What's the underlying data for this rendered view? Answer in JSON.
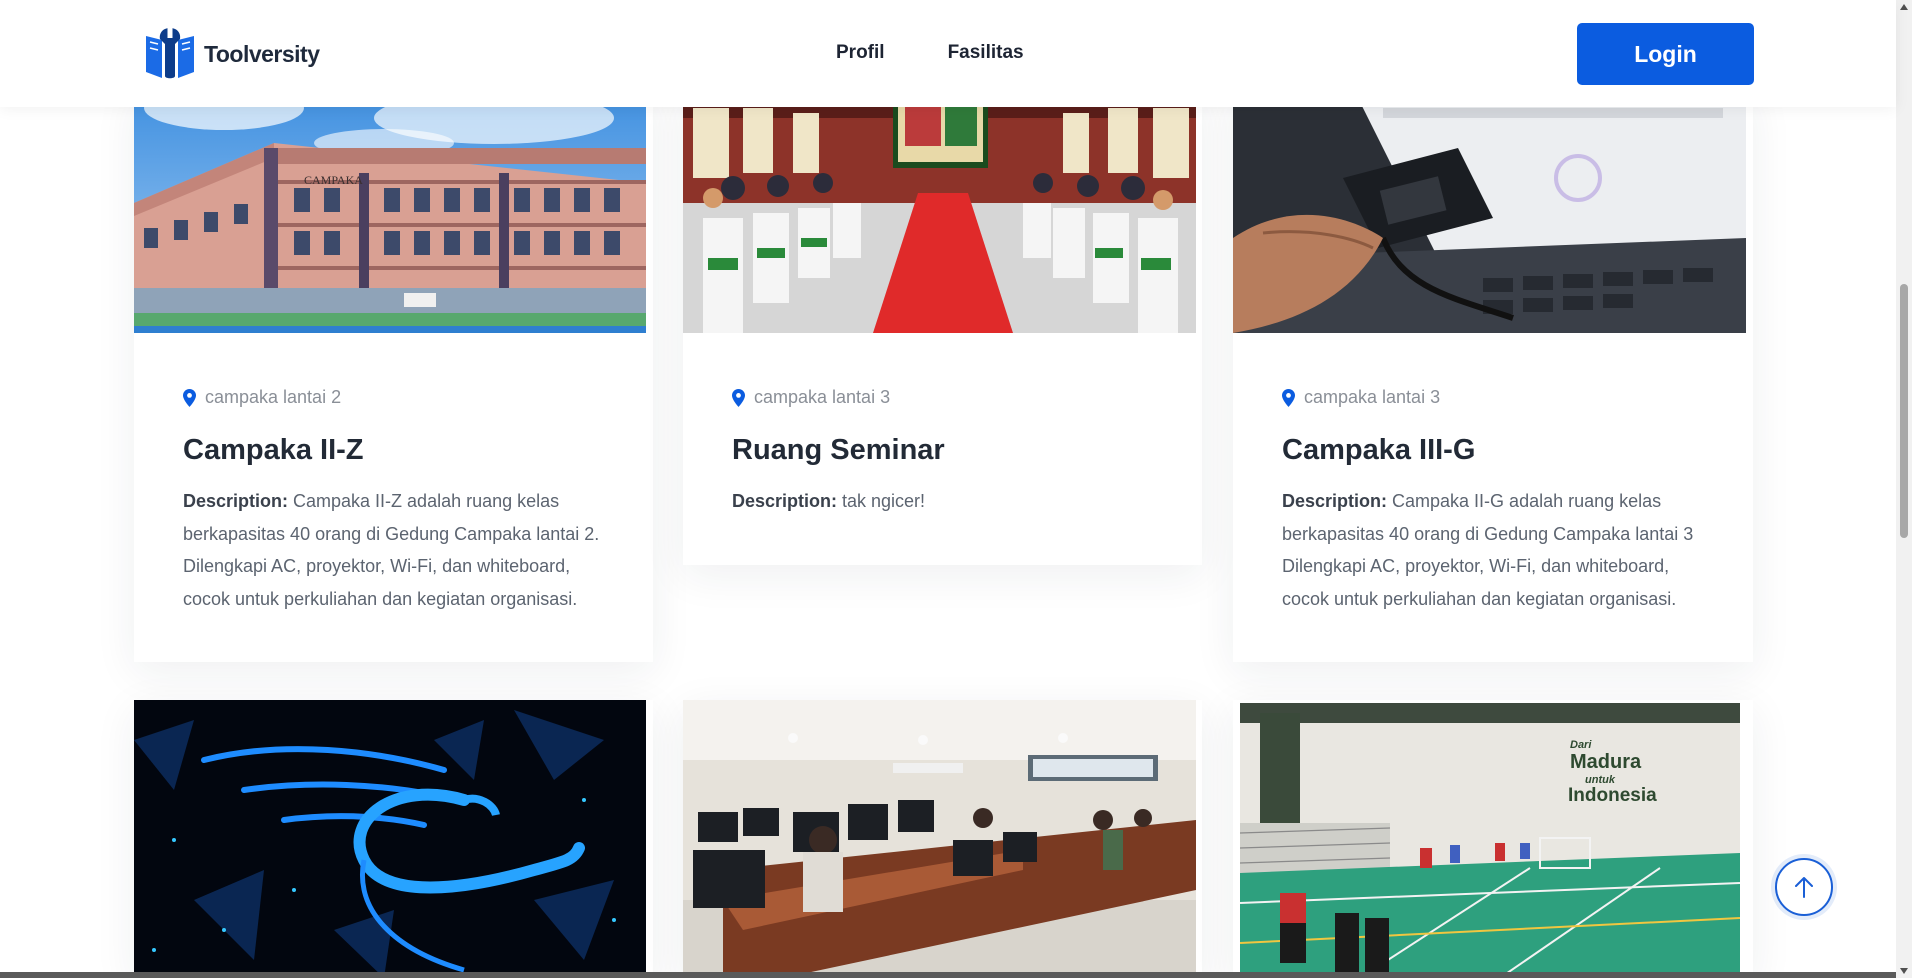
{
  "header": {
    "logo_text": "Toolversity",
    "nav": [
      {
        "label": "Profil"
      },
      {
        "label": "Fasilitas"
      }
    ],
    "login_label": "Login"
  },
  "cards": [
    {
      "location": "campaka lantai 2",
      "title": "Campaka II-Z",
      "desc_label": "Description:",
      "description": " Campaka II-Z adalah ruang kelas berkapasitas 40 orang di Gedung Campaka lantai 2. Dilengkapi AC, proyektor, Wi-Fi, dan whiteboard, cocok untuk perkuliahan dan kegiatan organisasi."
    },
    {
      "location": "campaka lantai 3",
      "title": "Ruang Seminar",
      "desc_label": "Description:",
      "description": " tak ngicer!"
    },
    {
      "location": "campaka lantai 3",
      "title": "Campaka III-G",
      "desc_label": "Description:",
      "description": " Campaka II-G adalah ruang kelas berkapasitas 40 orang di Gedung Campaka lantai 3 Dilengkapi AC, proyektor, Wi-Fi, dan whiteboard, cocok untuk perkuliahan dan kegiatan organisasi."
    }
  ],
  "images": {
    "building_sign": "CAMPAKA",
    "gym_sign_line1": "Dari",
    "gym_sign_line2": "Madura",
    "gym_sign_line3": "untuk",
    "gym_sign_line4": "Indonesia"
  },
  "colors": {
    "accent": "#0b5ce0",
    "title": "#222a36",
    "muted": "#8a8f97"
  },
  "icons": [
    "logo-icon",
    "location-pin-icon",
    "arrow-up-icon"
  ]
}
